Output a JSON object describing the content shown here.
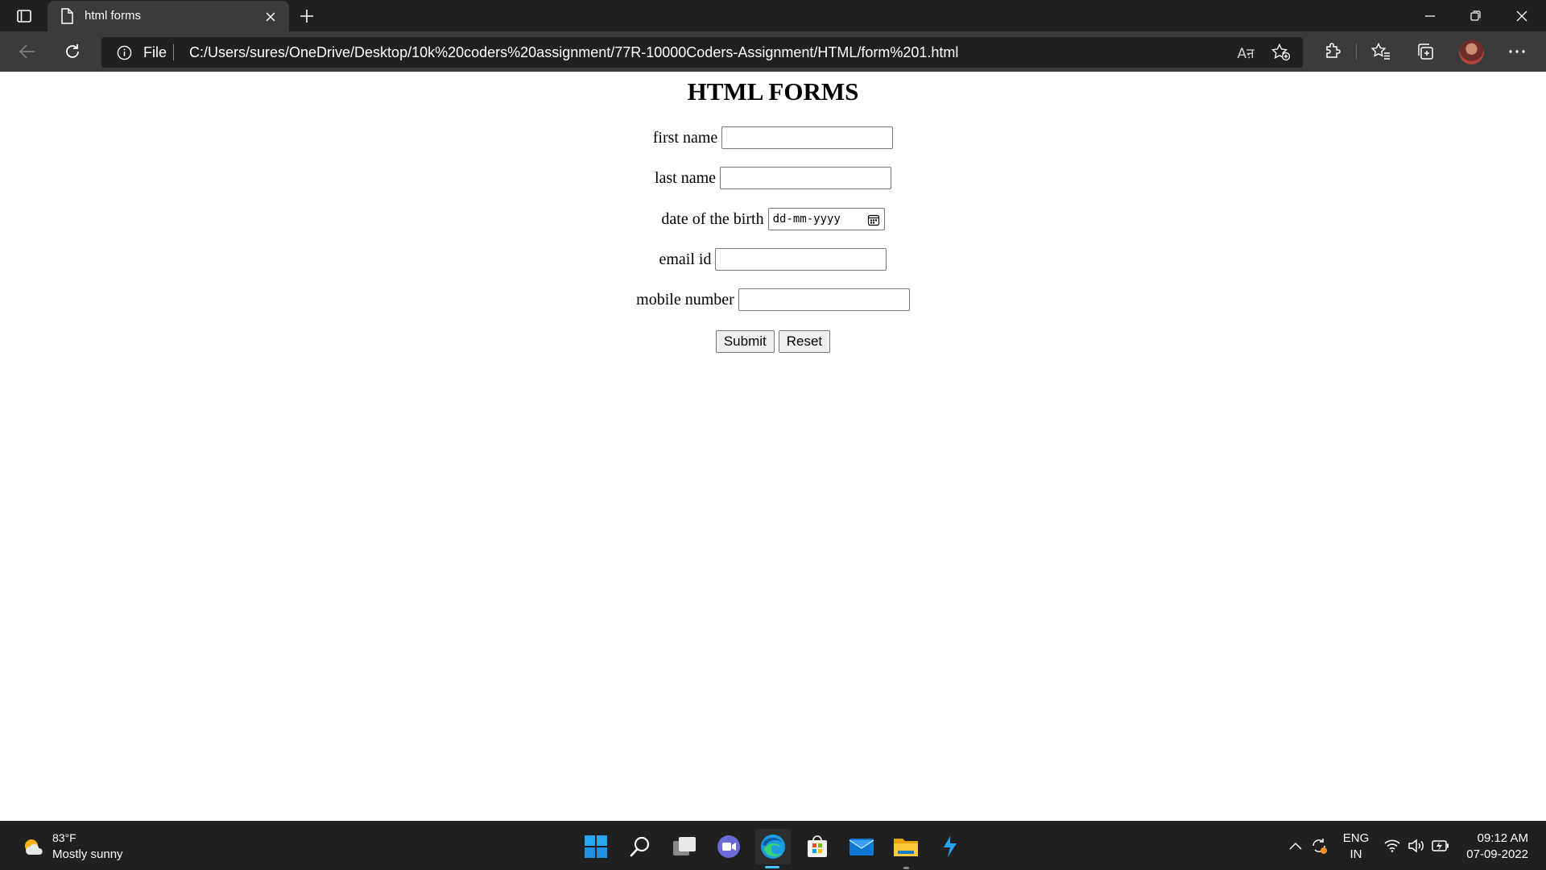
{
  "browser": {
    "tab_title": "html forms",
    "address_scheme": "File",
    "url": "C:/Users/sures/OneDrive/Desktop/10k%20coders%20assignment/77R-10000Coders-Assignment/HTML/form%201.html",
    "read_aloud_label": "Aऩ"
  },
  "page": {
    "heading": "HTML FORMS",
    "fields": [
      {
        "label": "first name"
      },
      {
        "label": "last name"
      },
      {
        "label": "date of the birth",
        "placeholder": "dd-mm-yyyy"
      },
      {
        "label": "email id"
      },
      {
        "label": "mobile number"
      }
    ],
    "submit_label": "Submit",
    "reset_label": "Reset"
  },
  "taskbar": {
    "weather_temp": "83°F",
    "weather_desc": "Mostly sunny",
    "lang_line1": "ENG",
    "lang_line2": "IN",
    "time": "09:12 AM",
    "date": "07-09-2022"
  },
  "colors": {
    "chrome_dark": "#202020",
    "chrome_mid": "#3b3b3b",
    "edge_accent": "#4cc2ff",
    "windows_blue": "#1da1f2"
  }
}
